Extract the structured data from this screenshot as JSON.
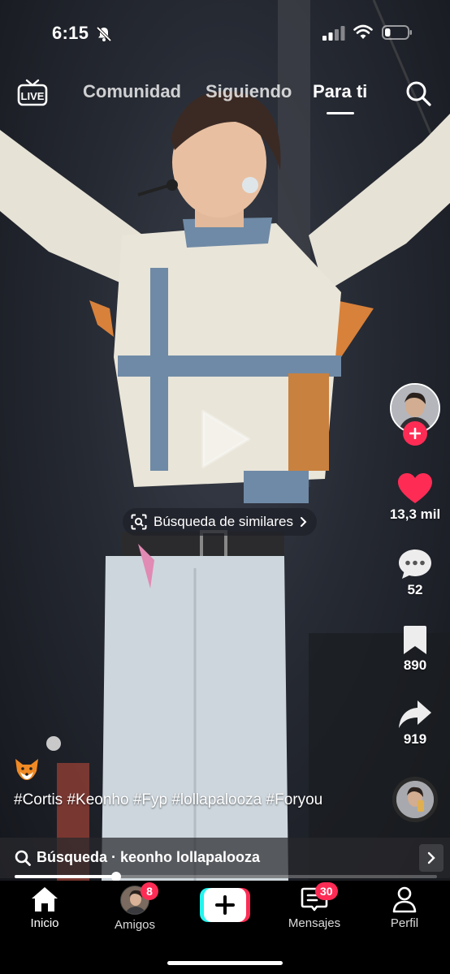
{
  "status_bar": {
    "time": "6:15",
    "battery_level": 0.25
  },
  "top_nav": {
    "live_label": "LIVE",
    "tabs": [
      {
        "label": "Comunidad",
        "active": false
      },
      {
        "label": "Siguiendo",
        "active": false
      },
      {
        "label": "Para ti",
        "active": true
      }
    ]
  },
  "video": {
    "similar_search_label": "Búsqueda de similares",
    "caption": "#Cortis #Keonho #Fyp #lollapalooza #Foryou",
    "progress": 0.24
  },
  "actions": {
    "likes": "13,3 mil",
    "comments": "52",
    "saves": "890",
    "shares": "919"
  },
  "search_suggestion": {
    "prefix": "Búsqueda",
    "separator": " · ",
    "query": "keonho lollapalooza"
  },
  "bottom_nav": {
    "items": [
      {
        "label": "Inicio",
        "active": true,
        "icon": "home-icon"
      },
      {
        "label": "Amigos",
        "badge": "8",
        "icon": "friends-avatar"
      },
      {
        "label": "",
        "icon": "plus-icon"
      },
      {
        "label": "Mensajes",
        "badge": "30",
        "icon": "inbox-icon"
      },
      {
        "label": "Perfil",
        "icon": "profile-icon"
      }
    ]
  },
  "colors": {
    "accent": "#fe2c55",
    "background": "#000000"
  }
}
